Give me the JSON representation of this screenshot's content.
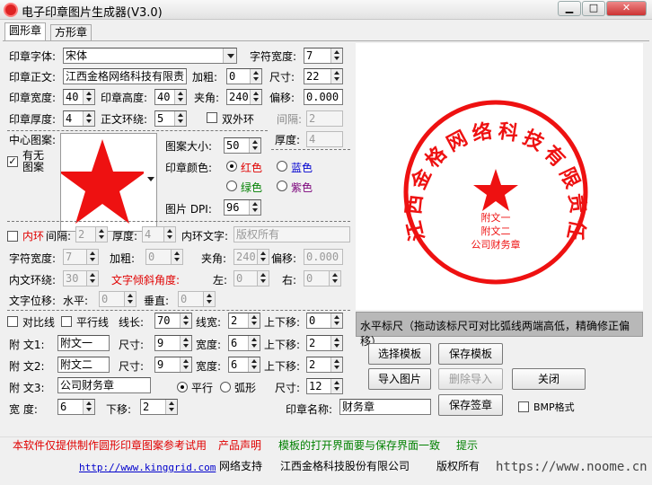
{
  "window": {
    "title": "电子印章图片生成器(V3.0)",
    "min": "▁",
    "max": "□",
    "close": "✕"
  },
  "tabs": [
    "圆形章",
    "方形章"
  ],
  "row1": {
    "font_label": "印章字体:",
    "font_value": "宋体",
    "charwidth_label": "字符宽度:",
    "charwidth_value": "7"
  },
  "row2": {
    "text_label": "印章正文:",
    "text_value": "江西金格网络科技有限责",
    "bold_label": "加粗:",
    "bold_value": "0",
    "size_label": "尺寸:",
    "size_value": "22"
  },
  "row3": {
    "width_label": "印章宽度:",
    "width_value": "40",
    "height_label": "印章高度:",
    "height_value": "40",
    "angle_label": "夹角:",
    "angle_value": "240",
    "offset_label": "偏移:",
    "offset_value": "0.000"
  },
  "row4": {
    "thick_label": "印章厚度:",
    "thick_value": "4",
    "ring_label": "正文环绕:",
    "ring_value": "5",
    "double_label": "双外环",
    "gap_label": "间隔:",
    "gap_value": "2",
    "thick2_label": "厚度:",
    "thick2_value": "4"
  },
  "center": {
    "label": "中心图案:",
    "has_label": "有无",
    "pattern_label": "图案",
    "size_label": "图案大小:",
    "size_value": "50",
    "color_label": "印章颜色:",
    "colors": [
      "红色",
      "蓝色",
      "绿色",
      "紫色"
    ],
    "dpi_label": "图片 DPI:",
    "dpi_value": "96"
  },
  "inner": {
    "ring_label": "内环",
    "gap_label": "间隔:",
    "gap_value": "2",
    "thick_label": "厚度:",
    "thick_value": "4",
    "text_label": "内环文字:",
    "text_value": "版权所有",
    "charwidth_label": "字符宽度:",
    "charwidth_value": "7",
    "bold_label": "加粗:",
    "bold_value": "0",
    "angle_label": "夹角:",
    "angle_value": "240",
    "offset_label": "偏移:",
    "offset_value": "0.000",
    "wrap_label": "内文环绕:",
    "wrap_value": "30",
    "tilt_label": "文字倾斜角度:",
    "left_label": "左:",
    "left_value": "0",
    "right_label": "右:",
    "right_value": "0",
    "shift_label": "文字位移:",
    "h_label": "水平:",
    "h_value": "0",
    "v_label": "垂直:",
    "v_value": "0"
  },
  "lines": {
    "compare_label": "对比线",
    "parallel_label": "平行线",
    "len_label": "线长:",
    "len_value": "70",
    "width_label": "线宽:",
    "width_value": "2",
    "updown_label": "上下移:",
    "updown_value": "0"
  },
  "fw1": {
    "label": "附  文1:",
    "value": "附文一",
    "size_label": "尺寸:",
    "size_value": "9",
    "width_label": "宽度:",
    "width_value": "6",
    "updown_label": "上下移:",
    "updown_value": "2"
  },
  "fw2": {
    "label": "附  文2:",
    "value": "附文二",
    "size_label": "尺寸:",
    "size_value": "9",
    "width_label": "宽度:",
    "width_value": "6",
    "updown_label": "上下移:",
    "updown_value": "2"
  },
  "fw3": {
    "label": "附  文3:",
    "value": "公司财务章",
    "parallel_label": "平行",
    "arc_label": "弧形",
    "size_label": "尺寸:",
    "size_value": "12"
  },
  "misc": {
    "width_label": "宽    度:",
    "width_value": "6",
    "down_label": "下移:",
    "down_value": "2",
    "name_label": "印章名称:",
    "name_value": "财务章",
    "bmp_label": "BMP格式"
  },
  "stamp": {
    "ring_text": "江西金格网络科技有限责任公司",
    "line1": "附文一",
    "line2": "附文二",
    "line3": "公司财务章"
  },
  "hint": "水平标尺（拖动该标尺可对比弧线两端高低，精确修正偏移）",
  "buttons": {
    "select_tpl": "选择模板",
    "save_tpl": "保存模板",
    "import_img": "导入图片",
    "delete_import": "删除导入",
    "close": "关闭",
    "save_sign": "保存签章"
  },
  "footer": {
    "notice": "本软件仅提供制作圆形印章图案参考试用",
    "product": "产品声明",
    "tpl_notice": "模板的打开界面要与保存界面一致",
    "tip": "提示",
    "url": "http://www.kinggrid.com",
    "support": "网络支持",
    "company": "江西金格科技股份有限公司",
    "rights": "版权所有",
    "watermark": "https://www.noome.cn"
  },
  "colors": {
    "stamp": "#ee1111"
  }
}
